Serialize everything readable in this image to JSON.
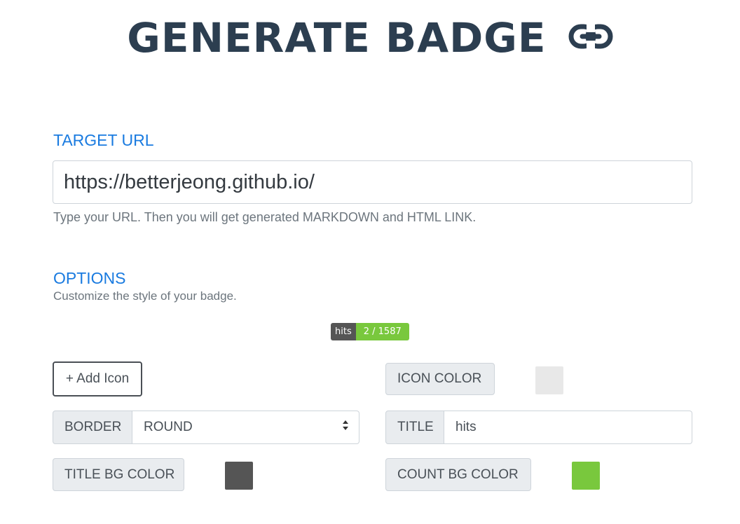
{
  "header": {
    "title": "GENERATE BADGE",
    "icon": "link-icon"
  },
  "target": {
    "section_title": "TARGET URL",
    "url_value": "https://betterjeong.github.io/",
    "helper": "Type your URL. Then you will get generated MARKDOWN and HTML LINK."
  },
  "options": {
    "section_title": "OPTIONS",
    "subtitle": "Customize the style of your badge.",
    "badge_preview": {
      "title": "hits",
      "count": "2 / 1587",
      "title_bg": "#555555",
      "count_bg": "#79c83d"
    },
    "add_icon_label": "+ Add Icon",
    "icon_color": {
      "label": "ICON COLOR",
      "color": "#e8e8e8"
    },
    "border": {
      "label": "BORDER",
      "selected": "ROUND"
    },
    "title_field": {
      "label": "TITLE",
      "value": "hits"
    },
    "title_bg_color": {
      "label": "TITLE BG COLOR",
      "color": "#555555"
    },
    "count_bg_color": {
      "label": "COUNT BG COLOR",
      "color": "#79c83d"
    }
  }
}
